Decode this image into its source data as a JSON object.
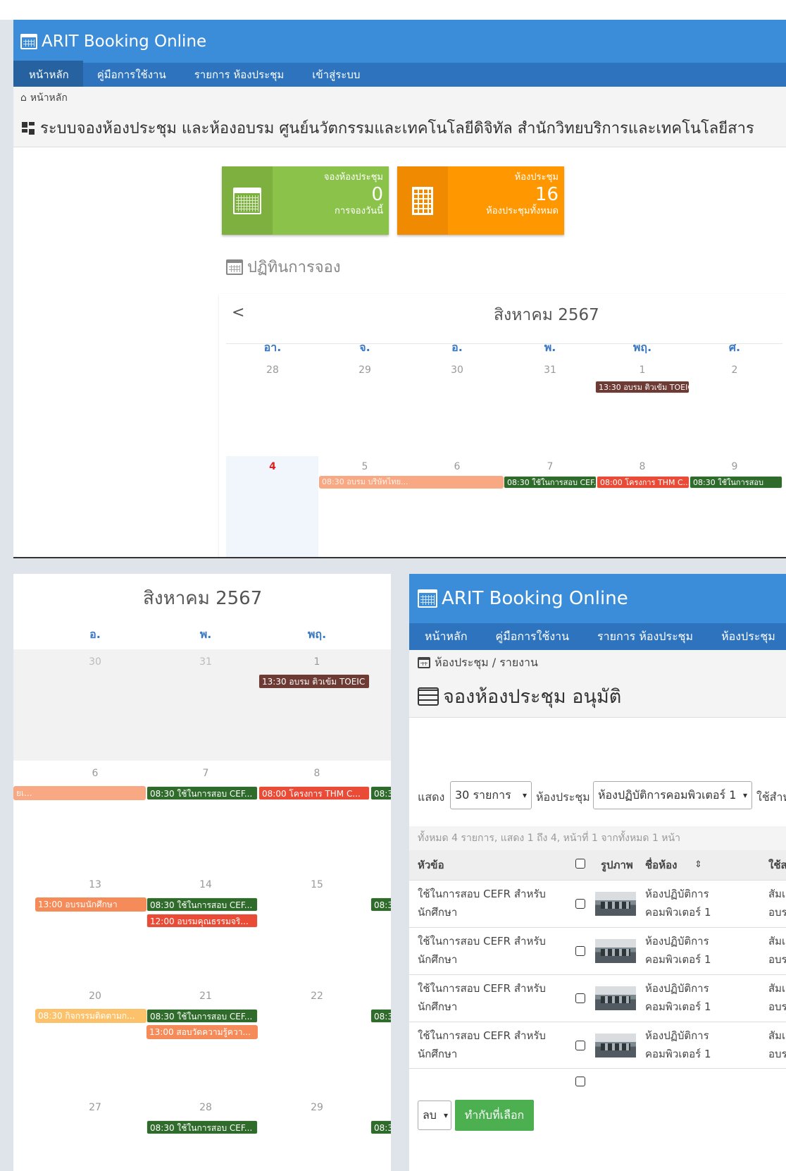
{
  "app": {
    "brand": "ARIT Booking Online",
    "colors": {
      "header": "#3c8dd9",
      "nav": "#2d73bd",
      "green": "#8bc34a",
      "orange": "#ff9800",
      "button": "#4caf50"
    }
  },
  "top": {
    "nav": [
      "หน้าหลัก",
      "คู่มือการใช้งาน",
      "รายการ ห้องประชุม",
      "เข้าสู่ระบบ"
    ],
    "breadcrumb": "หน้าหลัก",
    "title": "ระบบจองห้องประชุม และห้องอบรม ศูนย์นวัตกรรมและเทคโนโลยีดิจิทัล สำนักวิทยบริการและเทคโนโลยีสาร",
    "card_booking": {
      "label": "จองห้องประชุม",
      "value": "0",
      "sub": "การจองวันนี้"
    },
    "card_rooms": {
      "label": "ห้องประชุม",
      "value": "16",
      "sub": "ห้องประชุมทั้งหมด"
    },
    "calendar_heading": "ปฏิทินการจอง",
    "calendar": {
      "prev": "<",
      "month": "สิงหาคม 2567",
      "weekdays": [
        "อา.",
        "จ.",
        "อ.",
        "พ.",
        "พฤ.",
        "ศ."
      ],
      "week1": [
        "28",
        "29",
        "30",
        "31",
        "1",
        "2"
      ],
      "week2": [
        "4",
        "5",
        "6",
        "7",
        "8",
        "9"
      ],
      "events": {
        "e1": "13:30 อบรม ติวเข้ม TOEIC",
        "e2": "08:30 อบรม บริษัทไทย...",
        "e3": "08:30 ใช้ในการสอบ CEF...",
        "e4": "08:00 โครงการ THM C...",
        "e5": "08:30 ใช้ในการสอบ"
      }
    }
  },
  "bottom_left": {
    "month": "สิงหาคม 2567",
    "weekdays": [
      "อ.",
      "พ.",
      "พฤ."
    ],
    "weeks": [
      [
        "30",
        "31",
        "1"
      ],
      [
        "6",
        "7",
        "8"
      ],
      [
        "13",
        "14",
        "15"
      ],
      [
        "20",
        "21",
        "22"
      ],
      [
        "27",
        "28",
        "29"
      ]
    ],
    "events": {
      "w1_thu": "13:30 อบรม ติวเข้ม TOEIC",
      "w2_tail": "ยเ...",
      "w2_wed": "08:30 ใช้ในการสอบ CEF...",
      "w2_thu": "08:00 โครงการ THM C...",
      "w2_fri": "08:3",
      "w3_tue": "13:00 อบรมนักศึกษา",
      "w3_wed1": "08:30 ใช้ในการสอบ CEF...",
      "w3_wed2": "12:00 อบรมคุณธรรมจริ...",
      "w3_fri": "08:3",
      "w4_tue": "08:30 กิจกรรมติดตามก...",
      "w4_wed1": "08:30 ใช้ในการสอบ CEF...",
      "w4_wed2": "13:00 สอบวัดความรู้ควา...",
      "w4_fri": "08:3",
      "w5_wed": "08:30 ใช้ในการสอบ CEF...",
      "w5_fri": "08:3"
    }
  },
  "booking": {
    "brand": "ARIT Booking Online",
    "nav": [
      "หน้าหลัก",
      "คู่มือการใช้งาน",
      "รายการ ห้องประชุม",
      "ห้องประชุม"
    ],
    "breadcrumb": "ห้องประชุม / รายงาน",
    "title": "จองห้องประชุม อนุมัติ",
    "show_label": "แสดง",
    "show_value": "30 รายการ",
    "room_label": "ห้องประชุม",
    "room_value": "ห้องปฏิบัติการคอมพิวเตอร์ 1",
    "user_label": "ใช้สำห",
    "summary": "ทั้งหมด 4 รายการ, แสดง 1 ถึง 4, หน้าที่ 1 จากทั้งหมด 1 หน้า",
    "columns": {
      "topic": "หัวข้อ",
      "image": "รูปภาพ",
      "room": "ชื่อห้อง",
      "sort": "⇕",
      "user": "ใช้ส"
    },
    "rows": [
      {
        "topic1": "ใช้ในการสอบ CEFR สำหรับ",
        "topic2": "นักศึกษา",
        "room1": "ห้องปฏิบัติการ",
        "room2": "คอมพิวเตอร์ 1",
        "u1": "สัมเ",
        "u2": "อบร"
      },
      {
        "topic1": "ใช้ในการสอบ CEFR สำหรับ",
        "topic2": "นักศึกษา",
        "room1": "ห้องปฏิบัติการ",
        "room2": "คอมพิวเตอร์ 1",
        "u1": "สัมเ",
        "u2": "อบร"
      },
      {
        "topic1": "ใช้ในการสอบ CEFR สำหรับ",
        "topic2": "นักศึกษา",
        "room1": "ห้องปฏิบัติการ",
        "room2": "คอมพิวเตอร์ 1",
        "u1": "สัมเ",
        "u2": "อบร"
      },
      {
        "topic1": "ใช้ในการสอบ CEFR สำหรับ",
        "topic2": "นักศึกษา",
        "room1": "ห้องปฏิบัติการ",
        "room2": "คอมพิวเตอร์ 1",
        "u1": "สัมเ",
        "u2": "อบร"
      }
    ],
    "action_select": "ลบ",
    "action_button": "ทำกับที่เลือก"
  }
}
